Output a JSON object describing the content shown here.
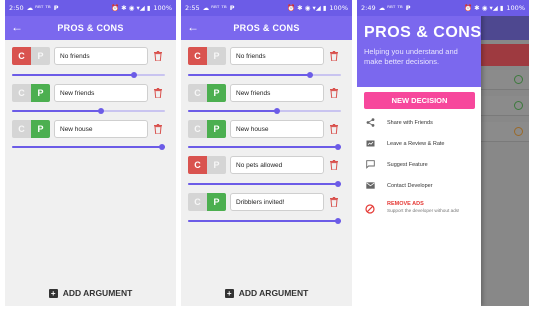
{
  "screens": [
    {
      "status": {
        "time": "2:50",
        "icons_left": "☁ ᴿᴮᵀ ᵀᴮ",
        "battery": "100%"
      },
      "title": "PROS & CONS",
      "arguments": [
        {
          "con_label": "C",
          "pro_label": "P",
          "selected": "con",
          "text": "No friends",
          "weight": 0.8
        },
        {
          "con_label": "C",
          "pro_label": "P",
          "selected": "pro",
          "text": "New friends",
          "weight": 0.58
        },
        {
          "con_label": "C",
          "pro_label": "P",
          "selected": "pro",
          "text": "New house",
          "weight": 1.0
        }
      ],
      "add_label": "ADD ARGUMENT"
    },
    {
      "status": {
        "time": "2:55",
        "icons_left": "☁ ᴿᴮᵀ ᵀᴮ",
        "battery": "100%"
      },
      "title": "PROS & CONS",
      "arguments": [
        {
          "con_label": "C",
          "pro_label": "P",
          "selected": "con",
          "text": "No friends",
          "weight": 0.8
        },
        {
          "con_label": "C",
          "pro_label": "P",
          "selected": "pro",
          "text": "New friends",
          "weight": 0.58
        },
        {
          "con_label": "C",
          "pro_label": "P",
          "selected": "pro",
          "text": "New house",
          "weight": 1.0
        },
        {
          "con_label": "C",
          "pro_label": "P",
          "selected": "con",
          "text": "No pets allowed",
          "weight": 1.0
        },
        {
          "con_label": "C",
          "pro_label": "P",
          "selected": "pro",
          "text": "Dribblers invited!",
          "weight": 1.0
        }
      ],
      "add_label": "ADD ARGUMENT"
    }
  ],
  "drawer": {
    "status": {
      "time": "2:49",
      "icons_left": "☁ ᴿᴮᵀ ᵀᴮ",
      "battery": "100%"
    },
    "title": "PROS & CONS",
    "subtitle": "Helping you understand and make better decisions.",
    "new_decision": "NEW DECISION",
    "menu": [
      {
        "icon": "share-icon",
        "label": "Share with Friends"
      },
      {
        "icon": "rate-icon",
        "label": "Leave a Review & Rate"
      },
      {
        "icon": "chat-icon",
        "label": "Suggest Feature"
      },
      {
        "icon": "mail-icon",
        "label": "Contact Developer"
      }
    ],
    "remove_ads": {
      "title": "REMOVE ADS",
      "subtitle": "Support the developer without ads!"
    }
  },
  "colors": {
    "primary": "#7b68ee",
    "status": "#6c5ce7",
    "con": "#d9534f",
    "pro": "#4caf50",
    "accent": "#f7479c"
  }
}
